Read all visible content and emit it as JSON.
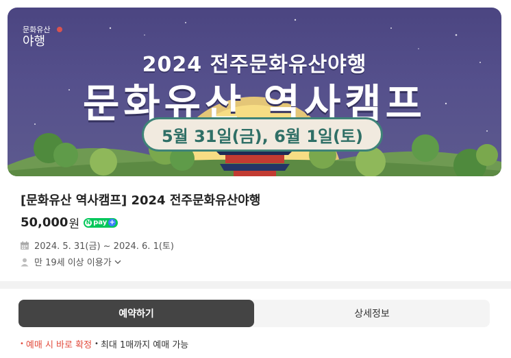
{
  "banner": {
    "logo_small": "문화유산",
    "logo_big": "야행",
    "subtitle": "2024 전주문화유산야행",
    "title": "문화유산 역사캠프",
    "dates": "5월 31일(금), 6월 1일(토)"
  },
  "product": {
    "title": "[문화유산 역사캠프] 2024 전주문화유산야행",
    "price": "50,000",
    "currency": "원",
    "pay_badge": "pay",
    "pay_n": "N",
    "pay_plus": "+"
  },
  "info": {
    "date_range": "2024. 5. 31(금) ~ 2024. 6. 1(토)",
    "age": "만 19세 이상 이용가"
  },
  "tabs": [
    {
      "label": "예약하기",
      "active": true
    },
    {
      "label": "상세정보",
      "active": false
    }
  ],
  "notice": {
    "item1": "예매 시 바로 확정",
    "item2": "최대 1매까지 예매 가능"
  },
  "icons": {
    "calendar": "calendar-icon",
    "person": "person-icon",
    "chevron": "chevron-down-icon"
  },
  "colors": {
    "banner_bg": "#4b4581",
    "tab_active": "#444444",
    "npay_green": "#03c75a",
    "notice_red": "#e24a3b"
  }
}
